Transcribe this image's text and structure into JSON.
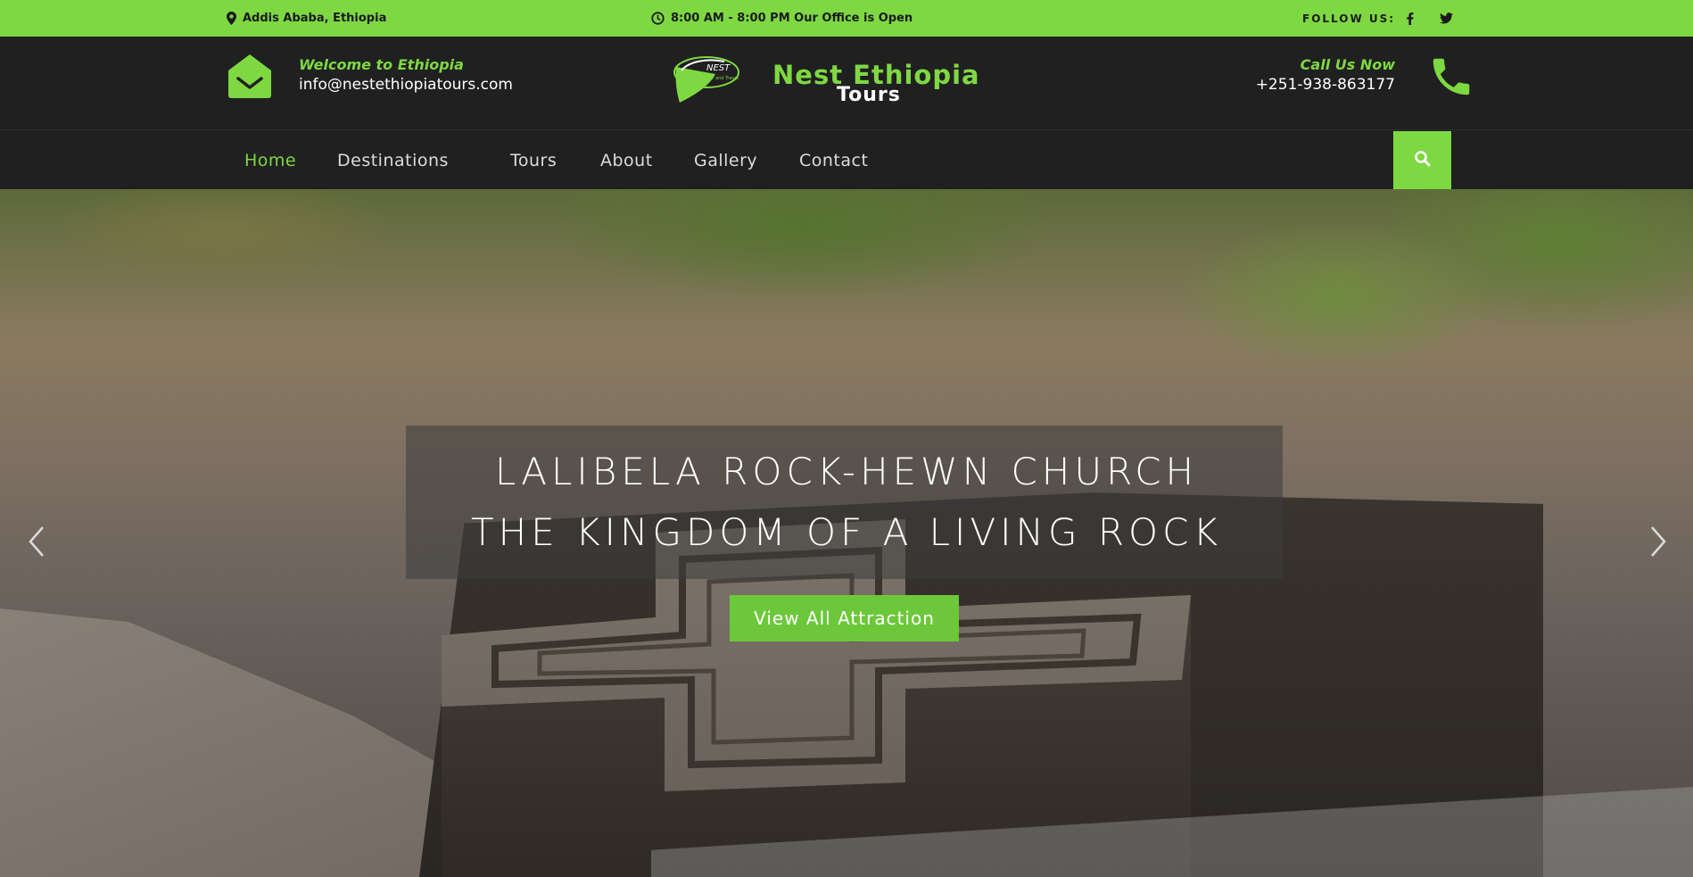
{
  "topbar": {
    "location": "Addis Ababa, Ethiopia",
    "hours": "8:00 AM - 8:00 PM Our Office is Open",
    "follow_label": "FOLLOW US:"
  },
  "header": {
    "welcome": "Welcome to Ethiopia",
    "email": "info@nestethiopiatours.com",
    "logo_badge": "NEST",
    "logo_badge_sub": "Tour and Travel",
    "logo_title": "Nest Ethiopia",
    "logo_subtitle": "Tours",
    "call_label": "Call Us Now",
    "phone": "+251-938-863177"
  },
  "nav": {
    "items": [
      {
        "label": "Home",
        "active": true
      },
      {
        "label": "Destinations",
        "active": false
      },
      {
        "label": "Tours",
        "active": false
      },
      {
        "label": "About",
        "active": false
      },
      {
        "label": "Gallery",
        "active": false
      },
      {
        "label": "Contact",
        "active": false
      }
    ]
  },
  "hero": {
    "line1": "LALIBELA ROCK-HEWN CHURCH",
    "line2": "THE KINGDOM OF A LIVING ROCK",
    "cta": "View All Attraction"
  },
  "icons": {
    "location": "map-marker-icon",
    "clock": "clock-icon",
    "facebook": "facebook-icon",
    "twitter": "twitter-icon",
    "mail": "envelope-open-icon",
    "phone": "phone-icon",
    "search": "search-icon",
    "prev": "chevron-left-icon",
    "next": "chevron-right-icon"
  },
  "colors": {
    "accent": "#7ed842",
    "dark": "#202020",
    "cta": "#6cc83a"
  }
}
